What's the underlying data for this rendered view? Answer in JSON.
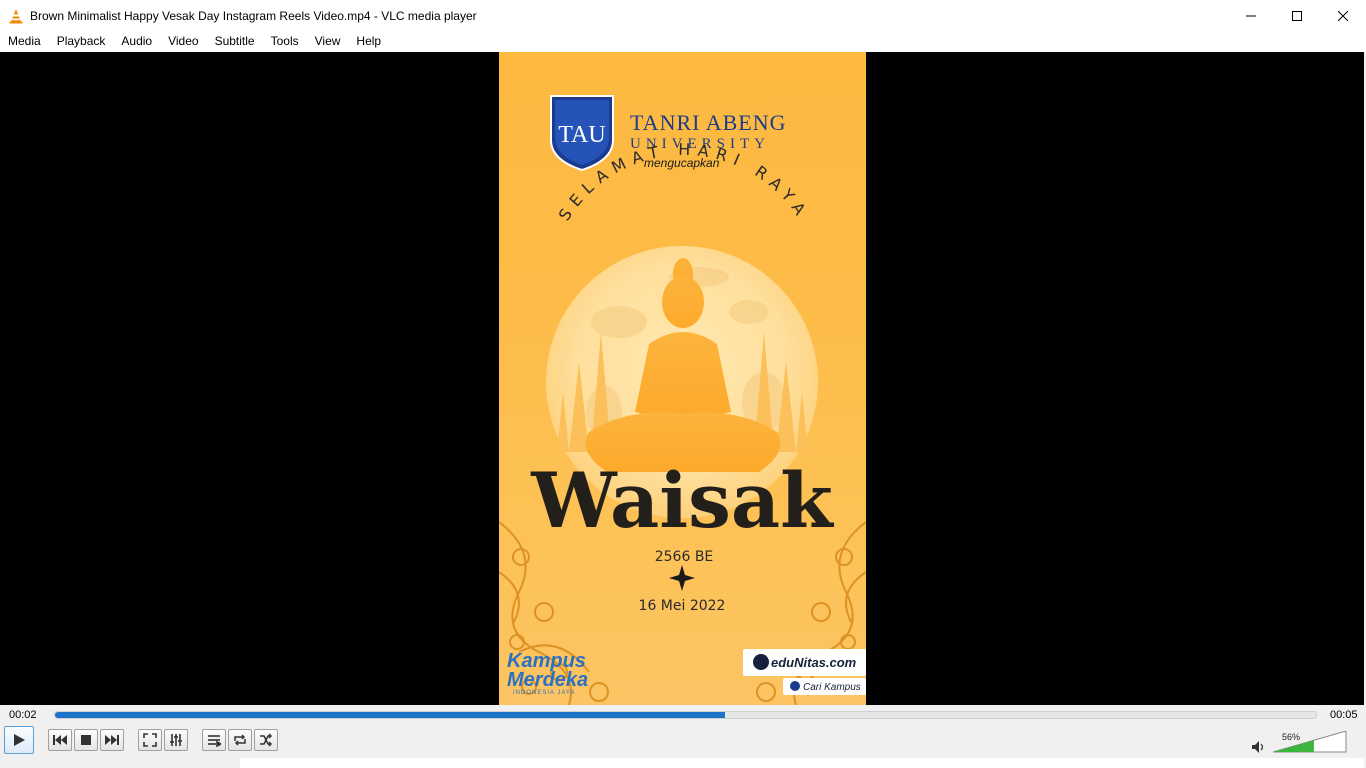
{
  "window": {
    "title": "Brown Minimalist Happy Vesak Day Instagram Reels Video.mp4 - VLC media player"
  },
  "menu": [
    "Media",
    "Playback",
    "Audio",
    "Video",
    "Subtitle",
    "Tools",
    "View",
    "Help"
  ],
  "video_frame": {
    "logo_text": "TAU",
    "university_line1": "TANRI ABENG",
    "university_line2": "UNIVERSITY",
    "greeting": "mengucapkan",
    "arc_text": "SELAMAT HARI RAYA",
    "headline": "Waisak",
    "year": "2566 BE",
    "date": "16 Mei 2022",
    "kampus_line1": "Kampus",
    "kampus_line2": "Merdeka",
    "kampus_sub": "INDONESIA JAYA",
    "edunitas": "eduNitas.com",
    "cari_kampus": "Cari Kampus"
  },
  "player": {
    "elapsed": "00:02",
    "total": "00:05",
    "progress_fraction": 0.531,
    "volume_label": "56%",
    "volume_fraction": 0.56
  },
  "colors": {
    "accent": "#1c73c9",
    "poster_bg": "#fdbc48",
    "university_blue": "#1d3b8c"
  }
}
